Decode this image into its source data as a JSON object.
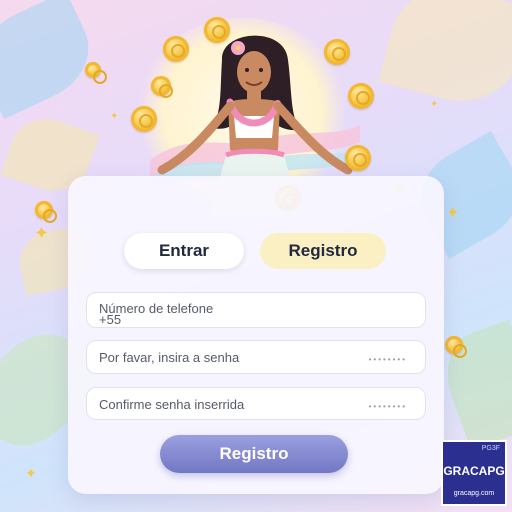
{
  "tabs": {
    "login_label": "Entrar",
    "register_label": "Registro"
  },
  "form": {
    "phone_placeholder": "Número de telefone",
    "phone_prefix": "+55",
    "password_placeholder": "Por favar, insira a senha",
    "password_mask": "••••••••",
    "confirm_placeholder": "Confirme senha inserrida",
    "confirm_mask": "••••••••"
  },
  "submit_label": "Registro",
  "badge": {
    "top_text": "PG3F",
    "name": "GRACAPG",
    "url": "gracapg.com"
  },
  "colors": {
    "accent": "#7c80cc",
    "active_tab": "#fbefc4",
    "badge_bg": "#2b2f8f",
    "coin": "#f7c948"
  }
}
